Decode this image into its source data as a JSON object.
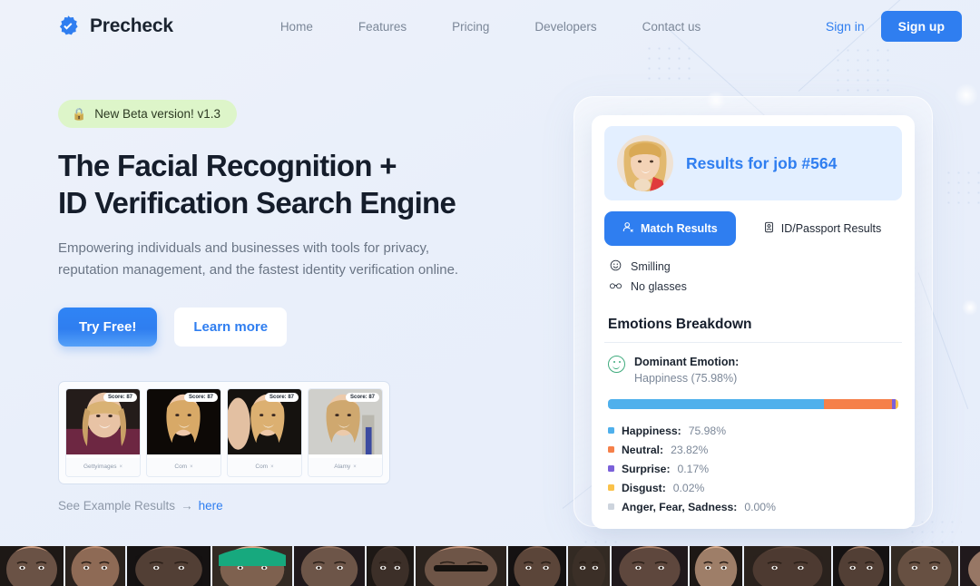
{
  "header": {
    "logo_icon": "verified-badge-icon",
    "brand": "Precheck",
    "nav": [
      {
        "label": "Home"
      },
      {
        "label": "Features"
      },
      {
        "label": "Pricing"
      },
      {
        "label": "Developers"
      },
      {
        "label": "Contact us"
      }
    ],
    "sign_in": "Sign in",
    "sign_up": "Sign up"
  },
  "hero": {
    "badge": {
      "icon": "lock-icon",
      "text": "New Beta version! v1.3"
    },
    "headline_line1": "The Facial Recognition +",
    "headline_line2": "ID Verification Search Engine",
    "subhead_line1": "Empowering individuals and businesses with tools for privacy,",
    "subhead_line2": "reputation management, and the fastest identity verification online.",
    "cta_primary": "Try Free!",
    "cta_secondary": "Learn more",
    "thumbnails": [
      {
        "score": "Score: 87",
        "source": "Gettyimages",
        "remove": "×"
      },
      {
        "score": "Score: 87",
        "source": "Com",
        "remove": "×"
      },
      {
        "score": "Score: 87",
        "source": "Com",
        "remove": "×"
      },
      {
        "score": "Score: 87",
        "source": "Alamy",
        "remove": "×"
      }
    ],
    "see_example_text": "See Example Results",
    "see_example_arrow": "→",
    "see_example_link": "here"
  },
  "result_card": {
    "job_title": "Results for job #564",
    "avatar_icon": "user-photo-avatar",
    "tabs": [
      {
        "label": "Match Results",
        "icon": "person-search-icon",
        "active": true
      },
      {
        "label": "ID/Passport Results",
        "icon": "id-card-icon",
        "active": false
      }
    ],
    "attributes": [
      {
        "icon": "smiley-face-icon",
        "glyph": "☺",
        "label": "Smilling"
      },
      {
        "icon": "glasses-icon",
        "glyph": "ͦ∂",
        "label": "No glasses"
      }
    ],
    "section_title": "Emotions Breakdown",
    "dominant": {
      "icon": "smiley-face-icon",
      "label": "Dominant Emotion:",
      "value": "Happiness (75.98%)"
    },
    "chart_data": {
      "type": "bar",
      "title": "Emotions Breakdown",
      "orientation": "stacked-horizontal",
      "categories": [
        "Happiness",
        "Neutral",
        "Surprise",
        "Disgust",
        "Anger, Fear, Sadness"
      ],
      "values": [
        75.98,
        23.82,
        0.17,
        0.02,
        0.0
      ],
      "labels": [
        "Happiness: 75.98%",
        "Neutral: 23.82%",
        "Surprise: 0.17%",
        "Disgust: 0.02%",
        "Anger, Fear, Sadness: 0.00%"
      ],
      "colors": [
        "#4fb0ec",
        "#f5804a",
        "#7b61d9",
        "#fac24a",
        "#cdd4dd"
      ],
      "unit": "%",
      "ylim": [
        0,
        100
      ]
    },
    "legend": [
      {
        "name": "Happiness:",
        "value": "75.98%",
        "color": "#4fb0ec"
      },
      {
        "name": "Neutral:",
        "value": "23.82%",
        "color": "#f5804a"
      },
      {
        "name": "Surprise:",
        "value": "0.17%",
        "color": "#7b61d9"
      },
      {
        "name": "Disgust:",
        "value": "0.02%",
        "color": "#fac24a"
      },
      {
        "name": "Anger, Fear, Sadness:",
        "value": "0.00%",
        "color": "#cdd4dd"
      }
    ]
  },
  "colors": {
    "accent_blue": "#2f7ef0",
    "badge_green": "#ddf5c9",
    "page_bg": "#e9eff8",
    "card_header_blue": "#e3efff"
  },
  "face_strip": {
    "name": "face-thumbnail-strip",
    "tones": [
      "#c89a7e",
      "#b98a6e",
      "#6e5346",
      "#d9a586",
      "#8f6f5c",
      "#4a3a31",
      "#c2937a",
      "#7a5c4b",
      "#3f3129",
      "#a87f66",
      "#d6ab8d",
      "#5c463a",
      "#9b7760",
      "#7e6150",
      "#caa086",
      "#4e3c33",
      "#b38a70",
      "#86654f",
      "#2f2a26",
      "#d2a98d",
      "#6b5244",
      "#a37e66"
    ]
  }
}
